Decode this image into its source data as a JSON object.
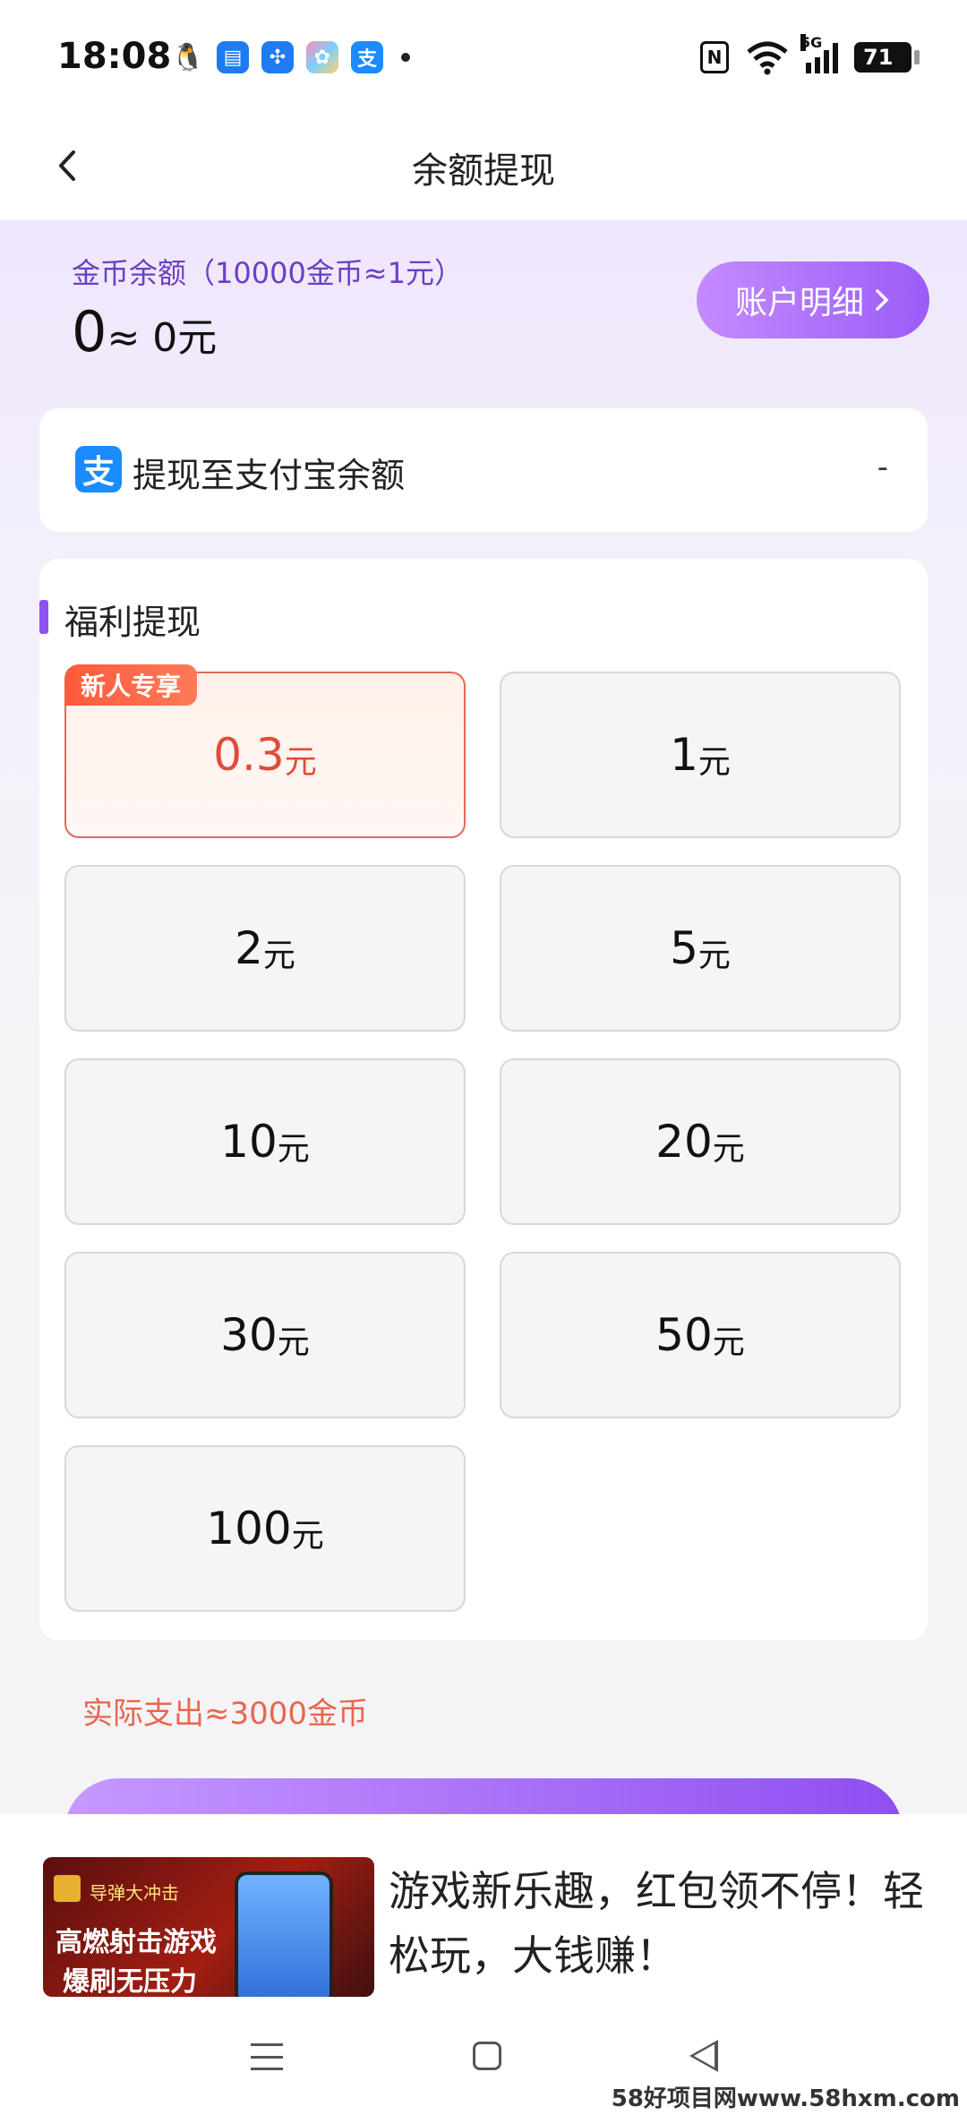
{
  "status_bar": {
    "time": "18:08",
    "notification_icons": [
      "qq-icon",
      "message-icon",
      "pinwheel-icon",
      "gallery-icon",
      "alipay-icon"
    ],
    "network": "5G",
    "battery": "71"
  },
  "header": {
    "title": "余额提现"
  },
  "balance": {
    "label": "金币余额（10000金币≈1元）",
    "coins": "0",
    "approx": "≈ 0元",
    "detail_button": "账户明细"
  },
  "withdraw_to": {
    "text": "提现至支付宝余额",
    "value": "-"
  },
  "welfare": {
    "title": "福利提现",
    "badge": "新人专享",
    "options": [
      {
        "amount": "0.3",
        "unit": "元",
        "selected": true
      },
      {
        "amount": "1",
        "unit": "元"
      },
      {
        "amount": "2",
        "unit": "元"
      },
      {
        "amount": "5",
        "unit": "元"
      },
      {
        "amount": "10",
        "unit": "元"
      },
      {
        "amount": "20",
        "unit": "元"
      },
      {
        "amount": "30",
        "unit": "元"
      },
      {
        "amount": "50",
        "unit": "元"
      },
      {
        "amount": "100",
        "unit": "元"
      }
    ]
  },
  "expense_note": "实际支出≈3000金币",
  "ad": {
    "game_name": "导弹大冲击",
    "image_line1": "高燃射击游戏",
    "image_line2": "爆刷无压力",
    "text": "游戏新乐趣，红包领不停！轻松玩，大钱赚！"
  },
  "watermark": "58好项目网www.58hxm.com",
  "colors": {
    "accent": "#9b5cf7",
    "selected": "#e24a3a",
    "expense": "#e8664e"
  }
}
